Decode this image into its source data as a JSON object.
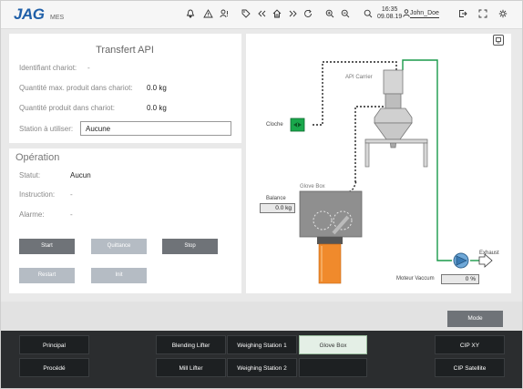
{
  "header": {
    "logo": "JAG",
    "logo_sub": "MES",
    "time": "16:35",
    "date": "09.08.19",
    "user": "John_Doe"
  },
  "icons": [
    "bell-icon",
    "alarm-warning-icon",
    "alarm-user-icon",
    "tag-icon",
    "rewind-icon",
    "home-icon",
    "forward-icon",
    "refresh-icon",
    "zoom-in-icon",
    "zoom-out-icon",
    "search-icon",
    "user-icon",
    "logout-icon",
    "fullscreen-icon",
    "settings-icon"
  ],
  "transfer": {
    "title": "Transfert API",
    "cart_id_label": "Identifiant chariot:",
    "cart_id_value": "-",
    "max_qty_label": "Quantité max. produit dans chariot:",
    "max_qty_value": "0.0 kg",
    "qty_label": "Quantité produit dans chariot:",
    "qty_value": "0.0 kg",
    "station_label": "Station à utiliser:",
    "station_value": "Aucune"
  },
  "operation": {
    "title": "Opération",
    "status_label": "Statut:",
    "status_value": "Aucun",
    "instruction_label": "Instruction:",
    "instruction_value": "-",
    "alarm_label": "Alarme:",
    "alarm_value": "-",
    "buttons": {
      "start": "Start",
      "quittance": "Quittance",
      "stop": "Stop",
      "restart": "Restart",
      "init": "Init"
    }
  },
  "diagram": {
    "api_carrier": "API Carrier",
    "cloche": "Cloche",
    "glove_box": "Glove Box",
    "balance_label": "Balance",
    "balance_value": "0.0 kg",
    "exhaust": "Exhaust",
    "vacuum_label": "Moteur Vaccum",
    "vacuum_value": "0 %",
    "colors": {
      "green_line": "#1a9a4a",
      "valve": "#1aa84c",
      "orange_tube": "#f08a2c",
      "pump": "#6fa8d8"
    }
  },
  "mode_label": "Mode",
  "nav": {
    "principal": "Principal",
    "procede": "Procédé",
    "blending_lifter": "Blending Lifter",
    "mill_lifter": "Mill Lifter",
    "weighing_station_1": "Weighing Station 1",
    "weighing_station_2": "Weighing Station 2",
    "glove_box": "Glove Box",
    "cip_xy": "CIP XY",
    "cip_satellite": "CIP Satellite"
  }
}
